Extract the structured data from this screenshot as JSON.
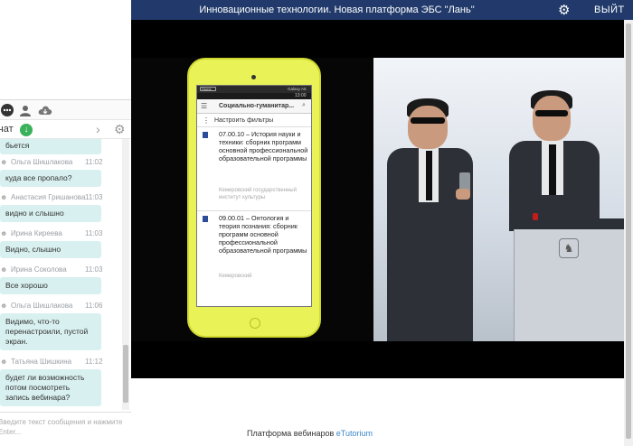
{
  "titlebar": {
    "title": "Инновационные технологии. Новая платформа ЭБС \"Лань\"",
    "exit_label": "ВЫЙТ"
  },
  "chat": {
    "title": "чат",
    "download_icon": "download-icon",
    "partial_top_message": "бьется",
    "messages": [
      {
        "author": "Ольга Шишлакова",
        "time": "11:02",
        "text": "куда все пропало?"
      },
      {
        "author": "Анастасия Гришанова",
        "time": "11:03",
        "text": "видно и слышно"
      },
      {
        "author": "Ирина Киреева",
        "time": "11:03",
        "text": "Видно, слышно"
      },
      {
        "author": "Ирина Соколова",
        "time": "11:03",
        "text": "Все хорошо"
      },
      {
        "author": "Ольга Шишлакова",
        "time": "11:06",
        "text": "Видимо, что-то перенастроили, пустой экран."
      },
      {
        "author": "Татьяна Шишкина",
        "time": "11:12",
        "text": "будет ли возможность потом посмотреть запись вебинара?"
      }
    ],
    "input_placeholder": "Введите текст сообщения и нажмите Enter..."
  },
  "phone_app": {
    "status_home": "Home",
    "status_device": "Galaxy A5",
    "status_clock": "13:00",
    "app_title": "Социально-гуманитар...",
    "filter_label": "Настроить фильтры",
    "items": [
      {
        "title": "07.00.10 – История науки и техники: сборник программ основной профессиональной образовательной программы",
        "publisher": "Кемеровский государственный институт культуры"
      },
      {
        "title": "09.00.01 – Онтология и теория познания: сборник программ основной профессиональной образовательной программы",
        "publisher": "Кемеровский"
      }
    ]
  },
  "footer": {
    "prefix": "Платформа вебинаров ",
    "brand": "eTutorium"
  },
  "colors": {
    "titlebar_bg": "#213a6b",
    "bubble_bg": "#d9f0f0",
    "phone_body": "#e9f257",
    "brand_link": "#3a86c8",
    "download_green": "#3ab15b"
  }
}
